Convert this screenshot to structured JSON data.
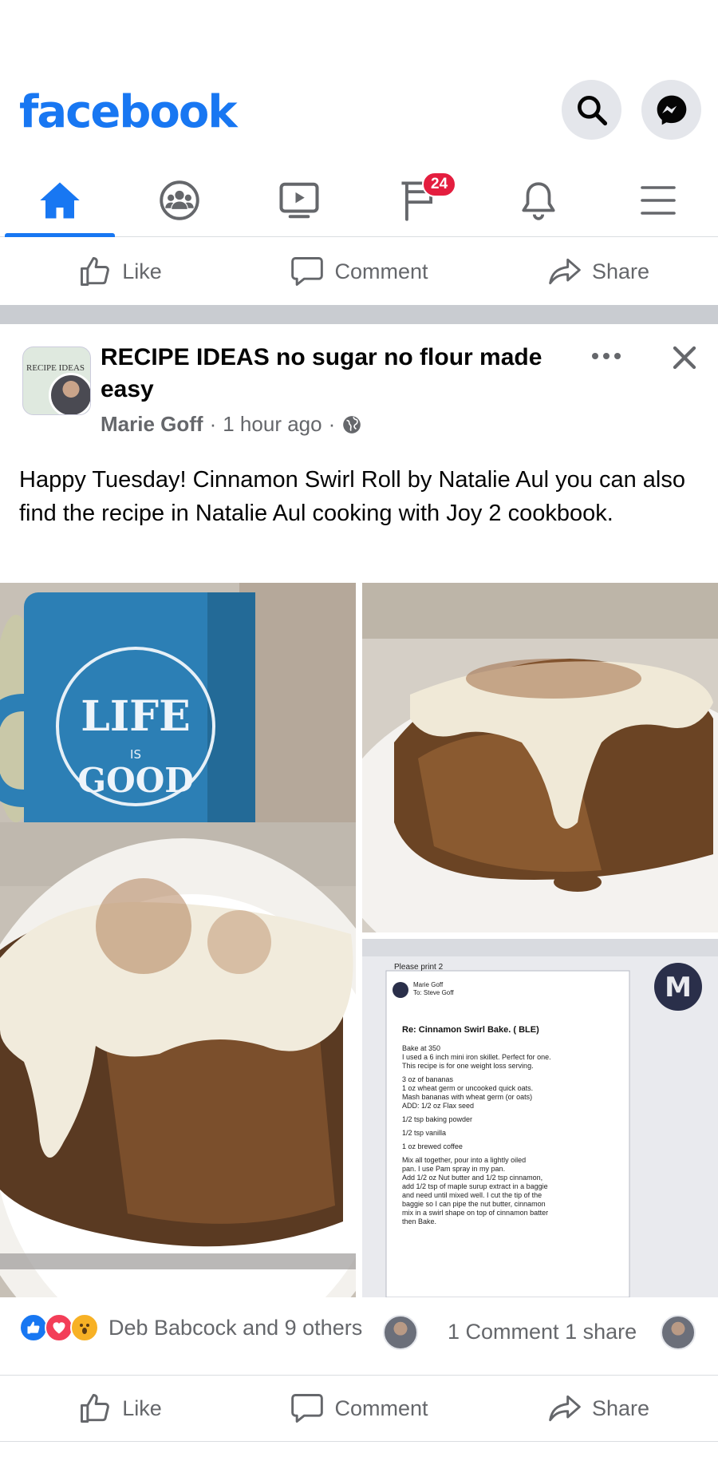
{
  "app": {
    "name": "facebook",
    "brand_color": "#1877f2"
  },
  "header": {
    "search_icon": "search-icon",
    "messenger_icon": "messenger-icon"
  },
  "nav": {
    "tabs": [
      {
        "name": "home",
        "icon": "home-icon",
        "active": true
      },
      {
        "name": "groups",
        "icon": "groups-icon"
      },
      {
        "name": "watch",
        "icon": "video-icon"
      },
      {
        "name": "feeds",
        "icon": "flag-icon",
        "badge": "24"
      },
      {
        "name": "notifications",
        "icon": "bell-icon"
      },
      {
        "name": "menu",
        "icon": "hamburger-icon"
      }
    ]
  },
  "action_bar": {
    "like": "Like",
    "comment": "Comment",
    "share": "Share"
  },
  "post": {
    "group_name": "RECIPE IDEAS no sugar no flour made easy",
    "group_avatar_text": "RECIPE IDEAS",
    "author": "Marie Goff",
    "time": "1 hour ago",
    "separator": "·",
    "text": "Happy Tuesday! Cinnamon Swirl Roll by Natalie Aul you can also find the recipe in Natalie Aul cooking with Joy 2 cookbook.",
    "photos": [
      {
        "description": "mug-and-cinnamon-roll",
        "mug_text": "LIFE IS GOOD"
      },
      {
        "description": "cinnamon-roll-closeup"
      },
      {
        "description": "recipe-email-screenshot",
        "email_subject": "Re: Cinnamon Swirl Bake. ( BLE)",
        "email_lines": [
          "Bake at 350",
          "I used a 6 inch mini iron skillet. Perfect for one.",
          "This recipe is for one weight loss serving.",
          "3 oz of bananas",
          "1 oz wheat germ or uncooked quick oats.",
          "Mash bananas with wheat germ (or oats)",
          "ADD: 1/2 oz Flax seed",
          "1/2 tsp baking powder",
          "1/2 tsp vanilla",
          "1 oz brewed coffee",
          "Mix all together, pour into a lightly oiled",
          "pan. I use Pam spray in my pan.",
          "Add 1/2 oz Nut butter and 1/2 tsp cinnamon,",
          "add 1/2 tsp of maple surup extract in a baggie",
          "and need until mixed well. I cut the tip of the",
          "baggie so I can pipe the nut butter, cinnamon",
          "mix in a swirl shape on top of cinnamon batter",
          "then Bake."
        ],
        "email_header": "Please print 2",
        "email_from": "Marie Goff",
        "email_to": "To: Steve Goff"
      }
    ],
    "reactions": {
      "names": "Deb Babcock and 9 others",
      "comments": "1 Comment",
      "shares": "1 share"
    }
  }
}
